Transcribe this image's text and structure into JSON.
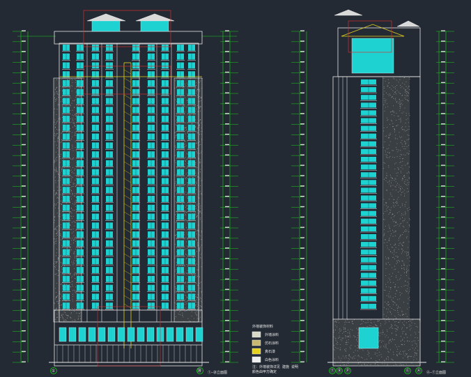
{
  "drawing": {
    "colors": {
      "background": "#232a33",
      "dimension": "#19d219",
      "outline": "#e8e8e8",
      "window": "#1ed2d2",
      "accent_yellow": "#e6d21e",
      "accent_red": "#d23232",
      "texture": "#9a9a9a"
    },
    "views": [
      {
        "id": "front",
        "axes_start": "①",
        "axes_end": "㉘",
        "title": "①—㉘立面图",
        "floors": 32
      },
      {
        "id": "side",
        "axes_start": "Ⓣ",
        "axes_mid": [
          "Ⓡ",
          "Ⓟ"
        ],
        "axes_end": "Ⓐ",
        "axes_end2": "Ⓖ",
        "title": "Ⓐ—Ⓣ立面图",
        "floors": 32
      }
    ],
    "legend": {
      "items": [
        {
          "swatch": "#d9d9c8",
          "text": "外墙涂料"
        },
        {
          "swatch": "#c8b870",
          "text": "仿石涂料"
        },
        {
          "swatch": "#e6d21e",
          "text": "真石漆"
        },
        {
          "swatch": "#efefef",
          "text": "白色涂料"
        }
      ],
      "heading": "外墙装饰材料",
      "note_line1": "注：外墙装饰详见 建施 说明",
      "note_line2": "颜色由甲方确定"
    }
  }
}
